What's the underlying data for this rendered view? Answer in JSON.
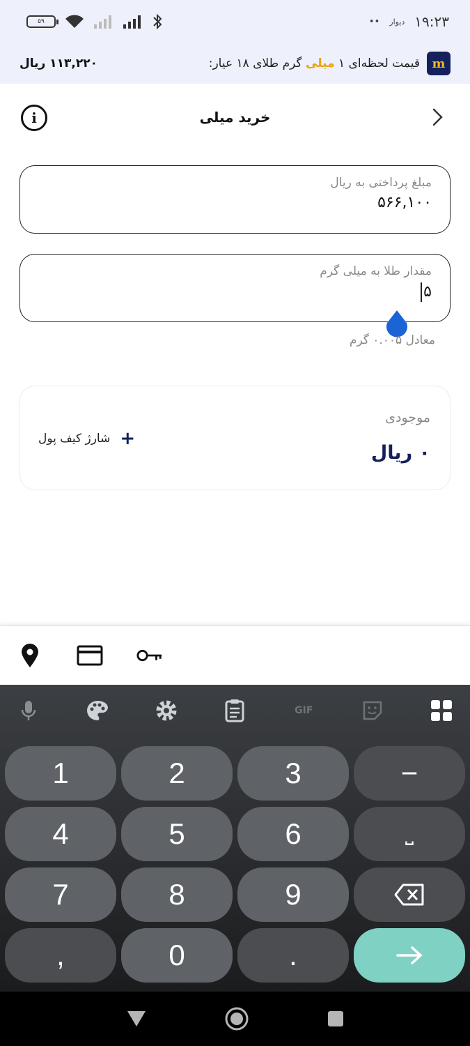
{
  "status_bar": {
    "time": "۱۹:۲۳",
    "app_label": "دیوار",
    "dots": "••",
    "battery_level": "۵۹"
  },
  "banner": {
    "text_before": "قیمت لحظه‌ای ۱",
    "text_highlight": "میلی",
    "text_after": "گرم طلای ۱۸ عیار:",
    "price": "۱۱۳,۲۲۰ ریال",
    "logo_letter": "m"
  },
  "header": {
    "title": "خرید میلی",
    "info_glyph": "i"
  },
  "payment_field": {
    "label": "مبلغ پرداختی به ریال",
    "value": "۵۶۶,۱۰۰"
  },
  "gold_field": {
    "label": "مقدار طلا به میلی گرم",
    "value": "۵"
  },
  "equivalent": "معادل ۰.۰۰۵ گرم",
  "balance": {
    "label": "موجودی",
    "value": "۰ ریال",
    "charge_plus": "+",
    "charge_label": "شارژ کیف پول"
  },
  "keyboard": {
    "gif_label": "GIF",
    "keys": [
      "1",
      "2",
      "3",
      "−",
      "4",
      "5",
      "6",
      "⎵",
      "7",
      "8",
      "9",
      "⌫",
      ",",
      "0",
      ".",
      "→"
    ]
  },
  "colors": {
    "brand": "#14215b",
    "highlight": "#e8a317",
    "enter_key": "#7fd1c4"
  }
}
